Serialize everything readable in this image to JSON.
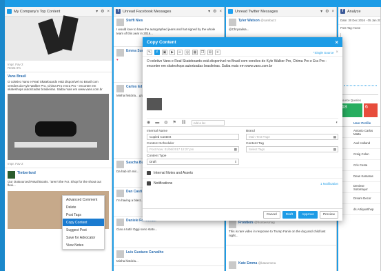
{
  "columns": [
    {
      "title": "My Company's Top Content"
    },
    {
      "title": "Unread Facebook Messages"
    },
    {
      "title": "Unread Twitter Messages"
    },
    {
      "title": "Analyze"
    }
  ],
  "col1": {
    "stats1": "Impr. Fav 2",
    "stats1b": "Retwt 0%",
    "post_name": "Vans Brasil",
    "post_text": "O coletivo Vans e Real Skateboards está disponível no Brasil com versões do Kyle Walker Pro, Chima Pro e Era Pro - encontre em skateshops autorizadas brasileiras. Saiba mais em www.vans.com.br",
    "stats2": "Impr. Fav 2",
    "post2_name": "Timberland",
    "post2_text": "Our Outsourced Retail Books. \"aren't the For. Shop for the shout out flexi..."
  },
  "menu": {
    "items": [
      "Advanced Comment",
      "Delete",
      "Post Tags",
      "Copy Content",
      "Suggest Post",
      "Save for Advocator",
      "View Notes"
    ],
    "active": "Copy Content"
  },
  "col2": {
    "posts": [
      {
        "name": "Steffi Nies",
        "text": "I would love to have the autographed jeans and hat signed by the whole team of this year in 2016..."
      },
      {
        "name": "Emma Sur",
        "text": "♥"
      },
      {
        "name": "Carlos Ed",
        "text": "Minha história... grande que ler e estar lá com você e com nosso time..."
      },
      {
        "name": "Sascha Bu",
        "text": "Da hab ich mir..."
      },
      {
        "name": "Dan Casti",
        "text": "I'm having a blast..."
      },
      {
        "name": "Daniele Formentin",
        "text": "Ciao a tutti! Oggi sono stato..."
      },
      {
        "name": "Luis Gustavo Carvalho",
        "text": "Minha história..."
      }
    ]
  },
  "col3": {
    "posts": [
      {
        "name": "Tyler Watson",
        "handle": "@cambuzz",
        "text": "@Chrysalisa..."
      },
      {
        "name": "Frontiers",
        "handle": "@frontiersmag",
        "text": "This is rare video in response to Trump Fanin on the dog and child last night..."
      },
      {
        "name": "Kate Emma",
        "handle": "@kateemma",
        "text": ""
      }
    ]
  },
  "modal": {
    "title": "Copy Content",
    "single_source": "*Single Source",
    "content_text": "O coletivo Vans e Real Skateboards está disponível no Brasil com versões do Kyle Walker Pro, Chima Pro e Era Pro - encontre em skateshops autorizadas brasileiras. Saiba mais em www.vans.com.br",
    "location_placeholder": "Add a loc",
    "internal_name_label": "Internal Name",
    "internal_name_value": "Copied Content",
    "brand_label": "Brand",
    "brand_value": "Main Test Page",
    "scheduler_label": "Content Scheduler",
    "scheduler_value": "Post Now: 01/06/2017 12:27 pm",
    "tag_label": "Content Tag",
    "tag_placeholder": "Select Tags",
    "type_label": "Content Type",
    "type_value": "Draft",
    "internal_notes": "Internal Notes and Assets",
    "notifications": "Notifications",
    "notif_count": "1 Notification",
    "cancel": "Cancel",
    "draft": "Draft",
    "approve": "Approve",
    "preview": "Preview"
  },
  "analyze": {
    "date": "Date: 30 Dec 2016 - 05 Jan 2017",
    "post_tag": "Post Tag: None",
    "metric1_label": "Source Queries",
    "metric1": "18",
    "metric2": "6",
    "table_head": "User Profile",
    "rows": [
      "Antonio Carlos Matta",
      "Axel Holland",
      "Craig Colon",
      "Cris Costa",
      "Dean Kamaras",
      "Deniese Sotomayor",
      "Dream Decor",
      "ds.ArtiquaShop"
    ]
  },
  "colors": {
    "accent": "#1d9ce6",
    "facebook": "#3b5998",
    "twitter": "#1da1f2"
  }
}
